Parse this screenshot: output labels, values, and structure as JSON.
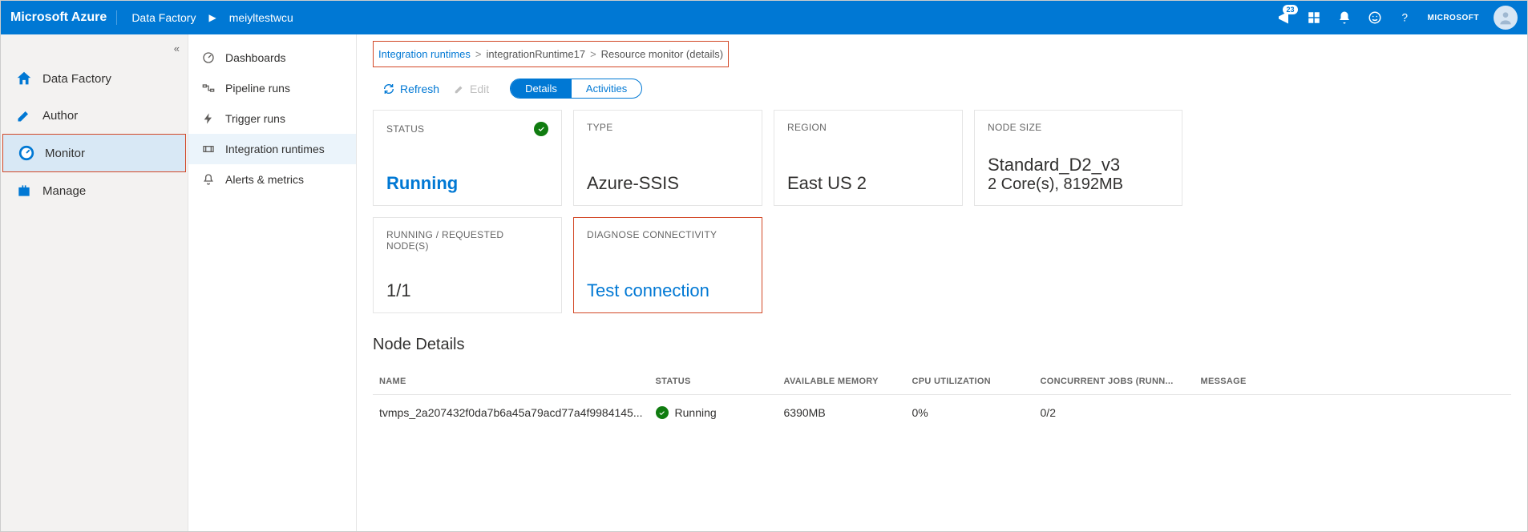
{
  "header": {
    "brand": "Microsoft Azure",
    "service": "Data Factory",
    "instance": "meiyltestwcu",
    "notification_count": "23",
    "tenant": "MICROSOFT"
  },
  "nav1": {
    "items": [
      {
        "label": "Data Factory",
        "icon": "home"
      },
      {
        "label": "Author",
        "icon": "pencil"
      },
      {
        "label": "Monitor",
        "icon": "gauge",
        "active": true
      },
      {
        "label": "Manage",
        "icon": "briefcase"
      }
    ]
  },
  "nav2": {
    "items": [
      {
        "label": "Dashboards",
        "icon": "speed"
      },
      {
        "label": "Pipeline runs",
        "icon": "pipeline"
      },
      {
        "label": "Trigger runs",
        "icon": "trigger"
      },
      {
        "label": "Integration runtimes",
        "icon": "ir",
        "active": true
      },
      {
        "label": "Alerts & metrics",
        "icon": "bell"
      }
    ]
  },
  "breadcrumb": {
    "root": "Integration runtimes",
    "mid": "integrationRuntime17",
    "leaf": "Resource monitor (details)"
  },
  "toolbar": {
    "refresh": "Refresh",
    "edit": "Edit",
    "tabs": {
      "details": "Details",
      "activities": "Activities"
    }
  },
  "cards": {
    "status": {
      "label": "STATUS",
      "value": "Running"
    },
    "type": {
      "label": "TYPE",
      "value": "Azure-SSIS"
    },
    "region": {
      "label": "REGION",
      "value": "East US 2"
    },
    "nodesize": {
      "label": "NODE SIZE",
      "value": "Standard_D2_v3",
      "sub": "2 Core(s), 8192MB"
    },
    "nodes": {
      "label": "RUNNING / REQUESTED NODE(S)",
      "value": "1/1"
    },
    "diagnose": {
      "label": "DIAGNOSE CONNECTIVITY",
      "value": "Test connection"
    }
  },
  "nodeDetails": {
    "title": "Node Details",
    "columns": [
      "NAME",
      "STATUS",
      "AVAILABLE MEMORY",
      "CPU UTILIZATION",
      "CONCURRENT JOBS (RUNN...",
      "MESSAGE"
    ],
    "row": {
      "name": "tvmps_2a207432f0da7b6a45a79acd77a4f9984145...",
      "status": "Running",
      "memory": "6390MB",
      "cpu": "0%",
      "jobs": "0/2",
      "message": ""
    }
  }
}
